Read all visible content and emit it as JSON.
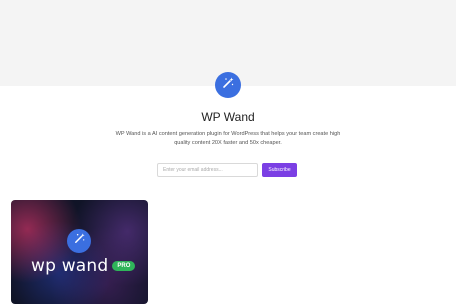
{
  "colors": {
    "top_band": "#f4f4f4",
    "brand_blue": "#3b6fe0",
    "subscribe_purple": "#7b3fe4",
    "pro_green": "#2fb45a"
  },
  "hero": {
    "logo_icon": "magic-wand-icon",
    "title": "WP Wand",
    "description": "WP Wand is a AI content generation plugin for WordPress that helps your team create high quality content 20X faster and 50x cheaper.",
    "email_placeholder": "Enter your email address...",
    "subscribe_label": "Subscribe"
  },
  "card": {
    "logo_icon": "magic-wand-icon",
    "wordmark": "wp wand",
    "badge": "PRO"
  }
}
